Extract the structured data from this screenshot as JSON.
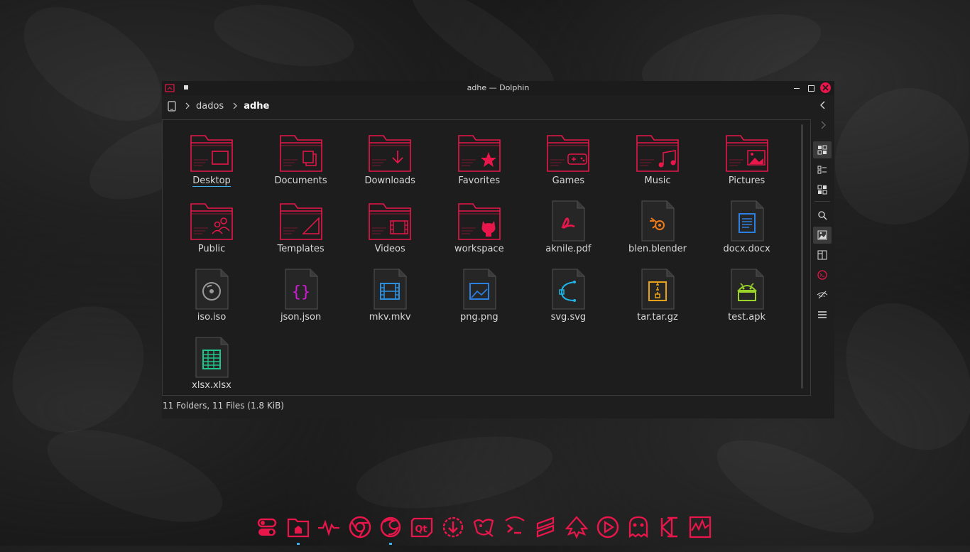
{
  "colors": {
    "accent": "#e8164a",
    "folder": "#e8164a",
    "window_bg": "#1e1e1e",
    "text": "#d8d8d8",
    "selection_underline": "#3daee9"
  },
  "window": {
    "title": "adhe — Dolphin"
  },
  "breadcrumb": {
    "device_icon": "tablet-device-icon",
    "items": [
      "dados",
      "adhe"
    ]
  },
  "items": [
    {
      "name": "Desktop",
      "kind": "folder",
      "emblem": "desktop",
      "selected": true
    },
    {
      "name": "Documents",
      "kind": "folder",
      "emblem": "documents"
    },
    {
      "name": "Downloads",
      "kind": "folder",
      "emblem": "download"
    },
    {
      "name": "Favorites",
      "kind": "folder",
      "emblem": "star"
    },
    {
      "name": "Games",
      "kind": "folder",
      "emblem": "gamepad"
    },
    {
      "name": "Music",
      "kind": "folder",
      "emblem": "music"
    },
    {
      "name": "Pictures",
      "kind": "folder",
      "emblem": "picture"
    },
    {
      "name": "Public",
      "kind": "folder",
      "emblem": "people"
    },
    {
      "name": "Templates",
      "kind": "folder",
      "emblem": "template"
    },
    {
      "name": "Videos",
      "kind": "folder",
      "emblem": "film"
    },
    {
      "name": "workspace",
      "kind": "folder",
      "emblem": "github"
    },
    {
      "name": "aknile.pdf",
      "kind": "file",
      "icon": "pdf-icon",
      "color": "#e8164a"
    },
    {
      "name": "blen.blender",
      "kind": "file",
      "icon": "blender-icon",
      "color": "#f07a1a"
    },
    {
      "name": "docx.docx",
      "kind": "file",
      "icon": "document-icon",
      "color": "#2b7fe0"
    },
    {
      "name": "iso.iso",
      "kind": "file",
      "icon": "disc-icon",
      "color": "#9a9a9a"
    },
    {
      "name": "json.json",
      "kind": "file",
      "icon": "braces-icon",
      "color": "#d21ad8"
    },
    {
      "name": "mkv.mkv",
      "kind": "file",
      "icon": "film-icon",
      "color": "#2b8fe0"
    },
    {
      "name": "png.png",
      "kind": "file",
      "icon": "image-icon",
      "color": "#2b7fe0"
    },
    {
      "name": "svg.svg",
      "kind": "file",
      "icon": "bezier-icon",
      "color": "#20b5e8"
    },
    {
      "name": "tar.tar.gz",
      "kind": "file",
      "icon": "archive-icon",
      "color": "#e8a21a"
    },
    {
      "name": "test.apk",
      "kind": "file",
      "icon": "android-icon",
      "color": "#9ad32a"
    },
    {
      "name": "xlsx.xlsx",
      "kind": "file",
      "icon": "spreadsheet-icon",
      "color": "#21c48a"
    }
  ],
  "status": {
    "text": "11 Folders, 11 Files (1.8 KiB)"
  },
  "sidebar": {
    "buttons": [
      "back-arrow-icon",
      "forward-arrow-icon",
      "icons-view-icon",
      "details-view-icon",
      "compact-view-icon",
      "search-icon",
      "preview-icon",
      "split-view-icon",
      "terminal-icon",
      "hidden-files-icon",
      "hamburger-menu-icon"
    ]
  },
  "dock": {
    "apps": [
      "toggle-settings-icon",
      "home-folder-icon",
      "system-monitor-icon",
      "chromium-icon",
      "firefox-icon",
      "qt-creator-icon",
      "software-updater-icon",
      "gimp-icon",
      "terminal-icon",
      "sublime-text-icon",
      "inkscape-icon",
      "media-player-icon",
      "ghost-icon",
      "kde-connect-icon",
      "activity-icon"
    ]
  }
}
